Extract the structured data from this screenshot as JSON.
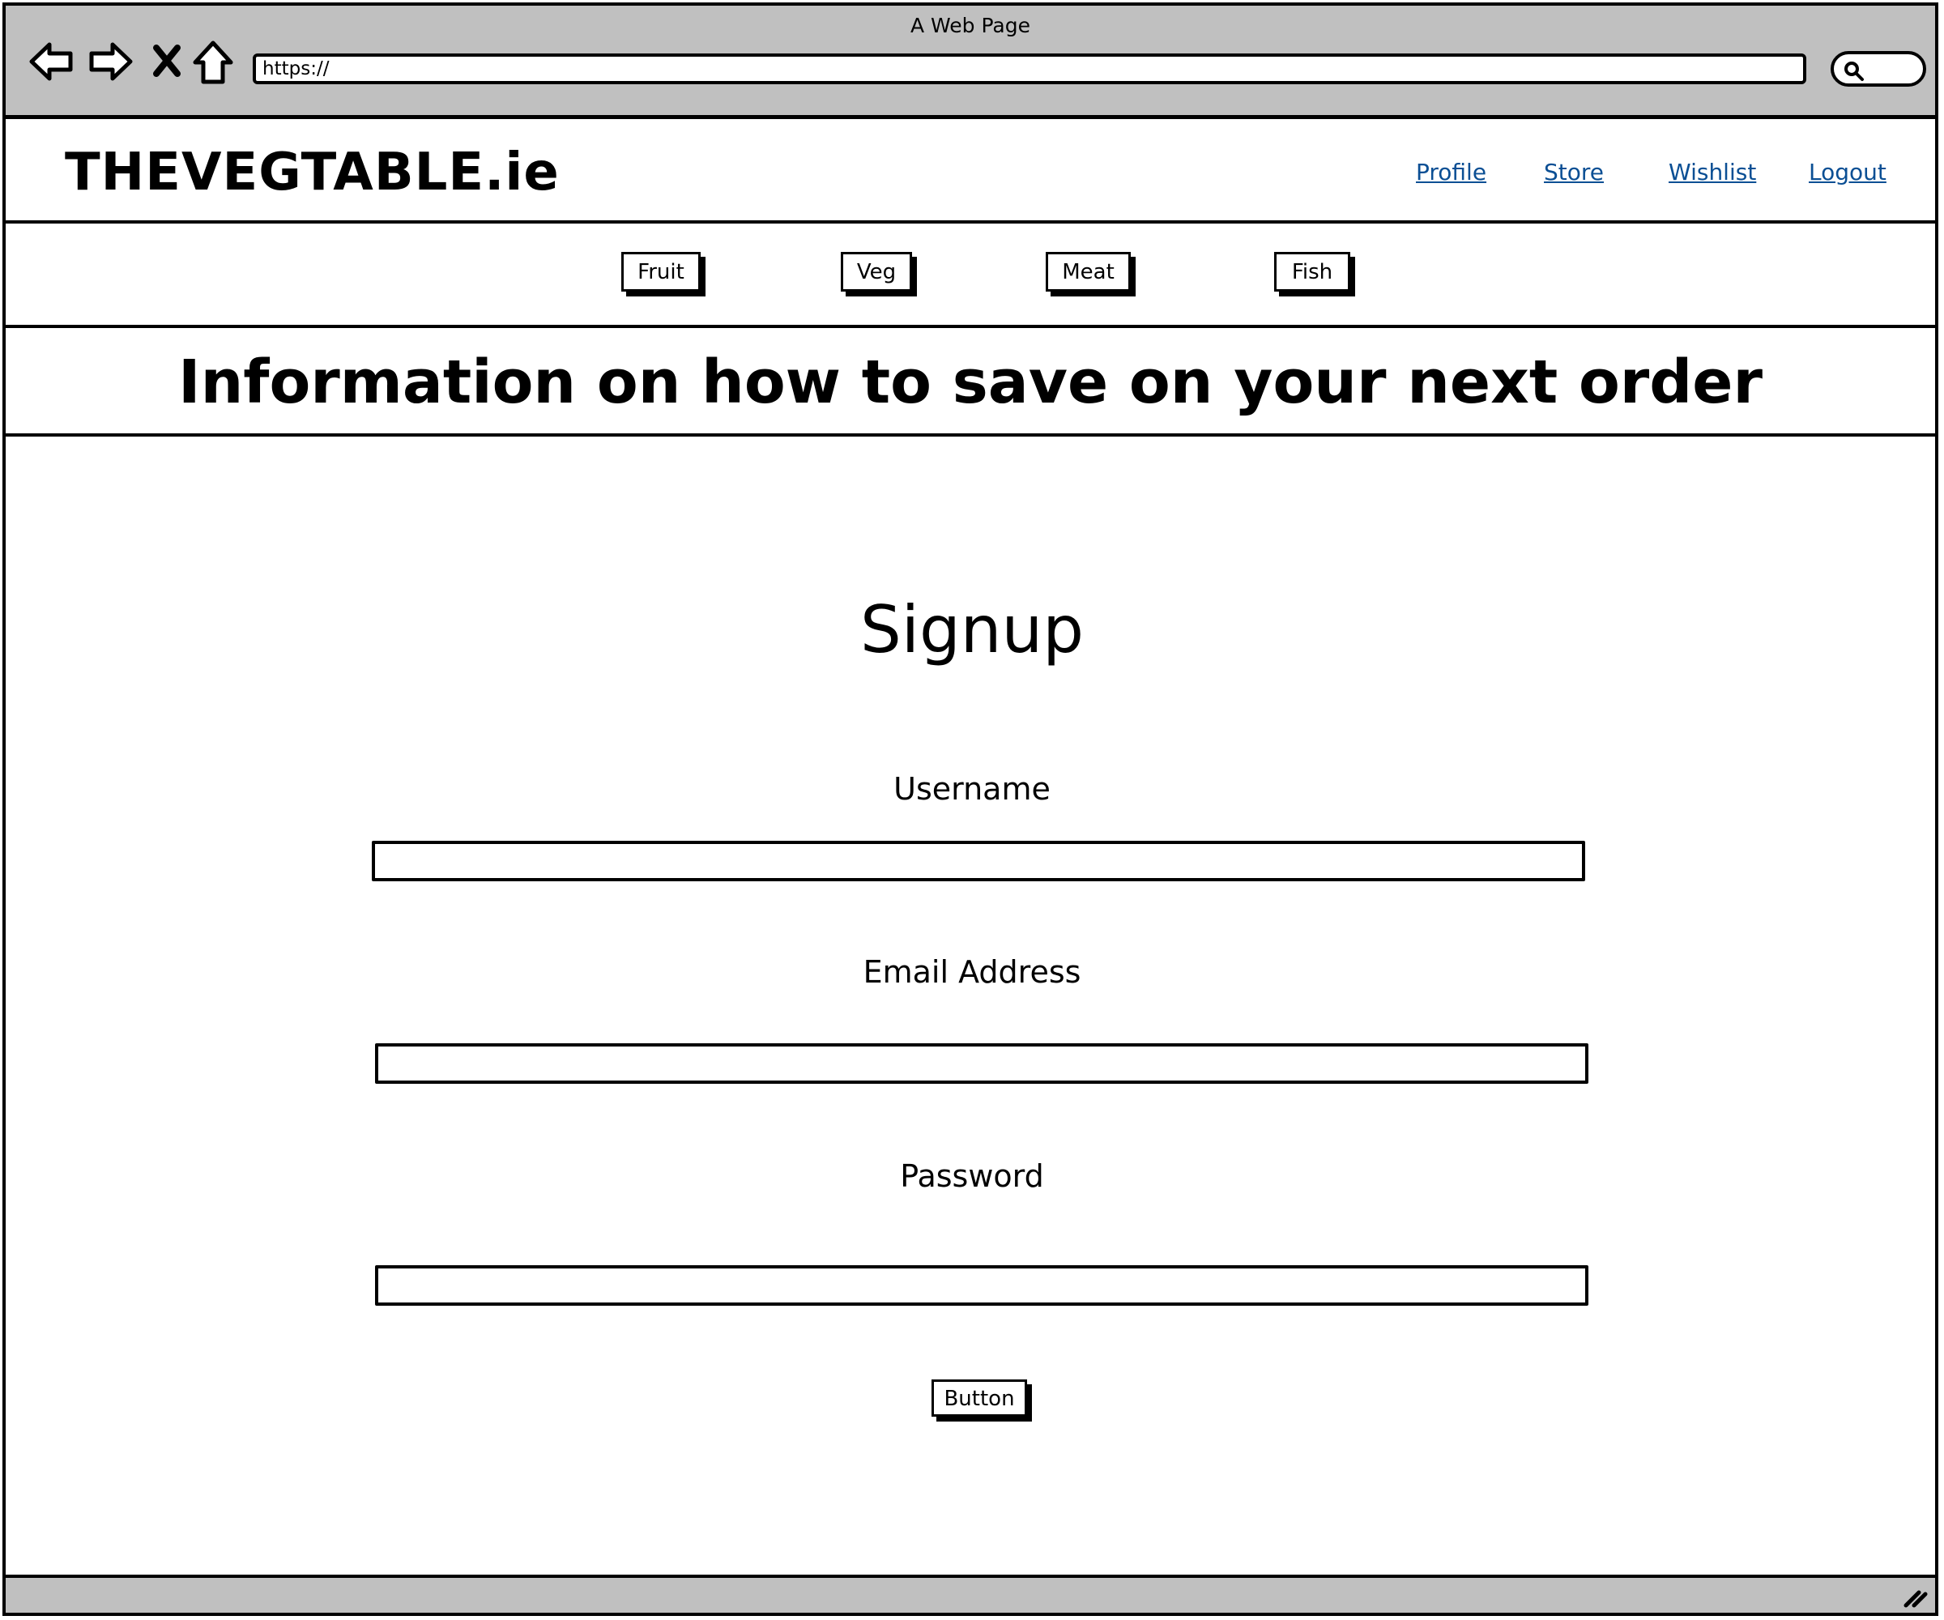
{
  "window": {
    "title": "A Web Page"
  },
  "browser": {
    "url": "https://",
    "icons": [
      "back-arrow-icon",
      "forward-arrow-icon",
      "close-x-icon",
      "home-icon",
      "search-icon"
    ]
  },
  "header": {
    "logo": "THEVEGTABLE.ie",
    "links": [
      "Profile",
      "Store",
      "Wishlist",
      "Logout"
    ],
    "link_color": "#0b4f94"
  },
  "categories": [
    "Fruit",
    "Veg",
    "Meat",
    "Fish"
  ],
  "banner": {
    "text": "Information on how to save on your next order"
  },
  "form": {
    "title": "Signup",
    "fields": [
      {
        "label": "Username",
        "value": ""
      },
      {
        "label": "Email Address",
        "value": ""
      },
      {
        "label": "Password",
        "value": ""
      }
    ],
    "submit_label": "Button"
  },
  "colors": {
    "chrome_bg": "#c0c0c0",
    "link": "#0b4f94"
  }
}
